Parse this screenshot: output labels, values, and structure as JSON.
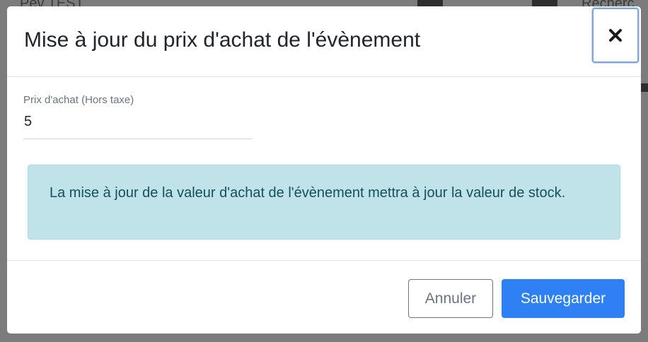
{
  "background": {
    "left_text": "Pev TEST",
    "right_text": "Recherc"
  },
  "modal": {
    "title": "Mise à jour du prix d'achat de l'évènement",
    "close_icon": "close-icon",
    "field": {
      "label": "Prix d'achat (Hors taxe)",
      "value": "5"
    },
    "info_message": "La mise à jour de la valeur d'achat de l'évènement mettra à jour la valeur de stock.",
    "cancel_label": "Annuler",
    "save_label": "Sauvegarder"
  },
  "colors": {
    "primary": "#2f7ff5",
    "info_bg": "#bfe3e8",
    "info_text": "#14505c",
    "focus_ring": "#80a5d9"
  }
}
